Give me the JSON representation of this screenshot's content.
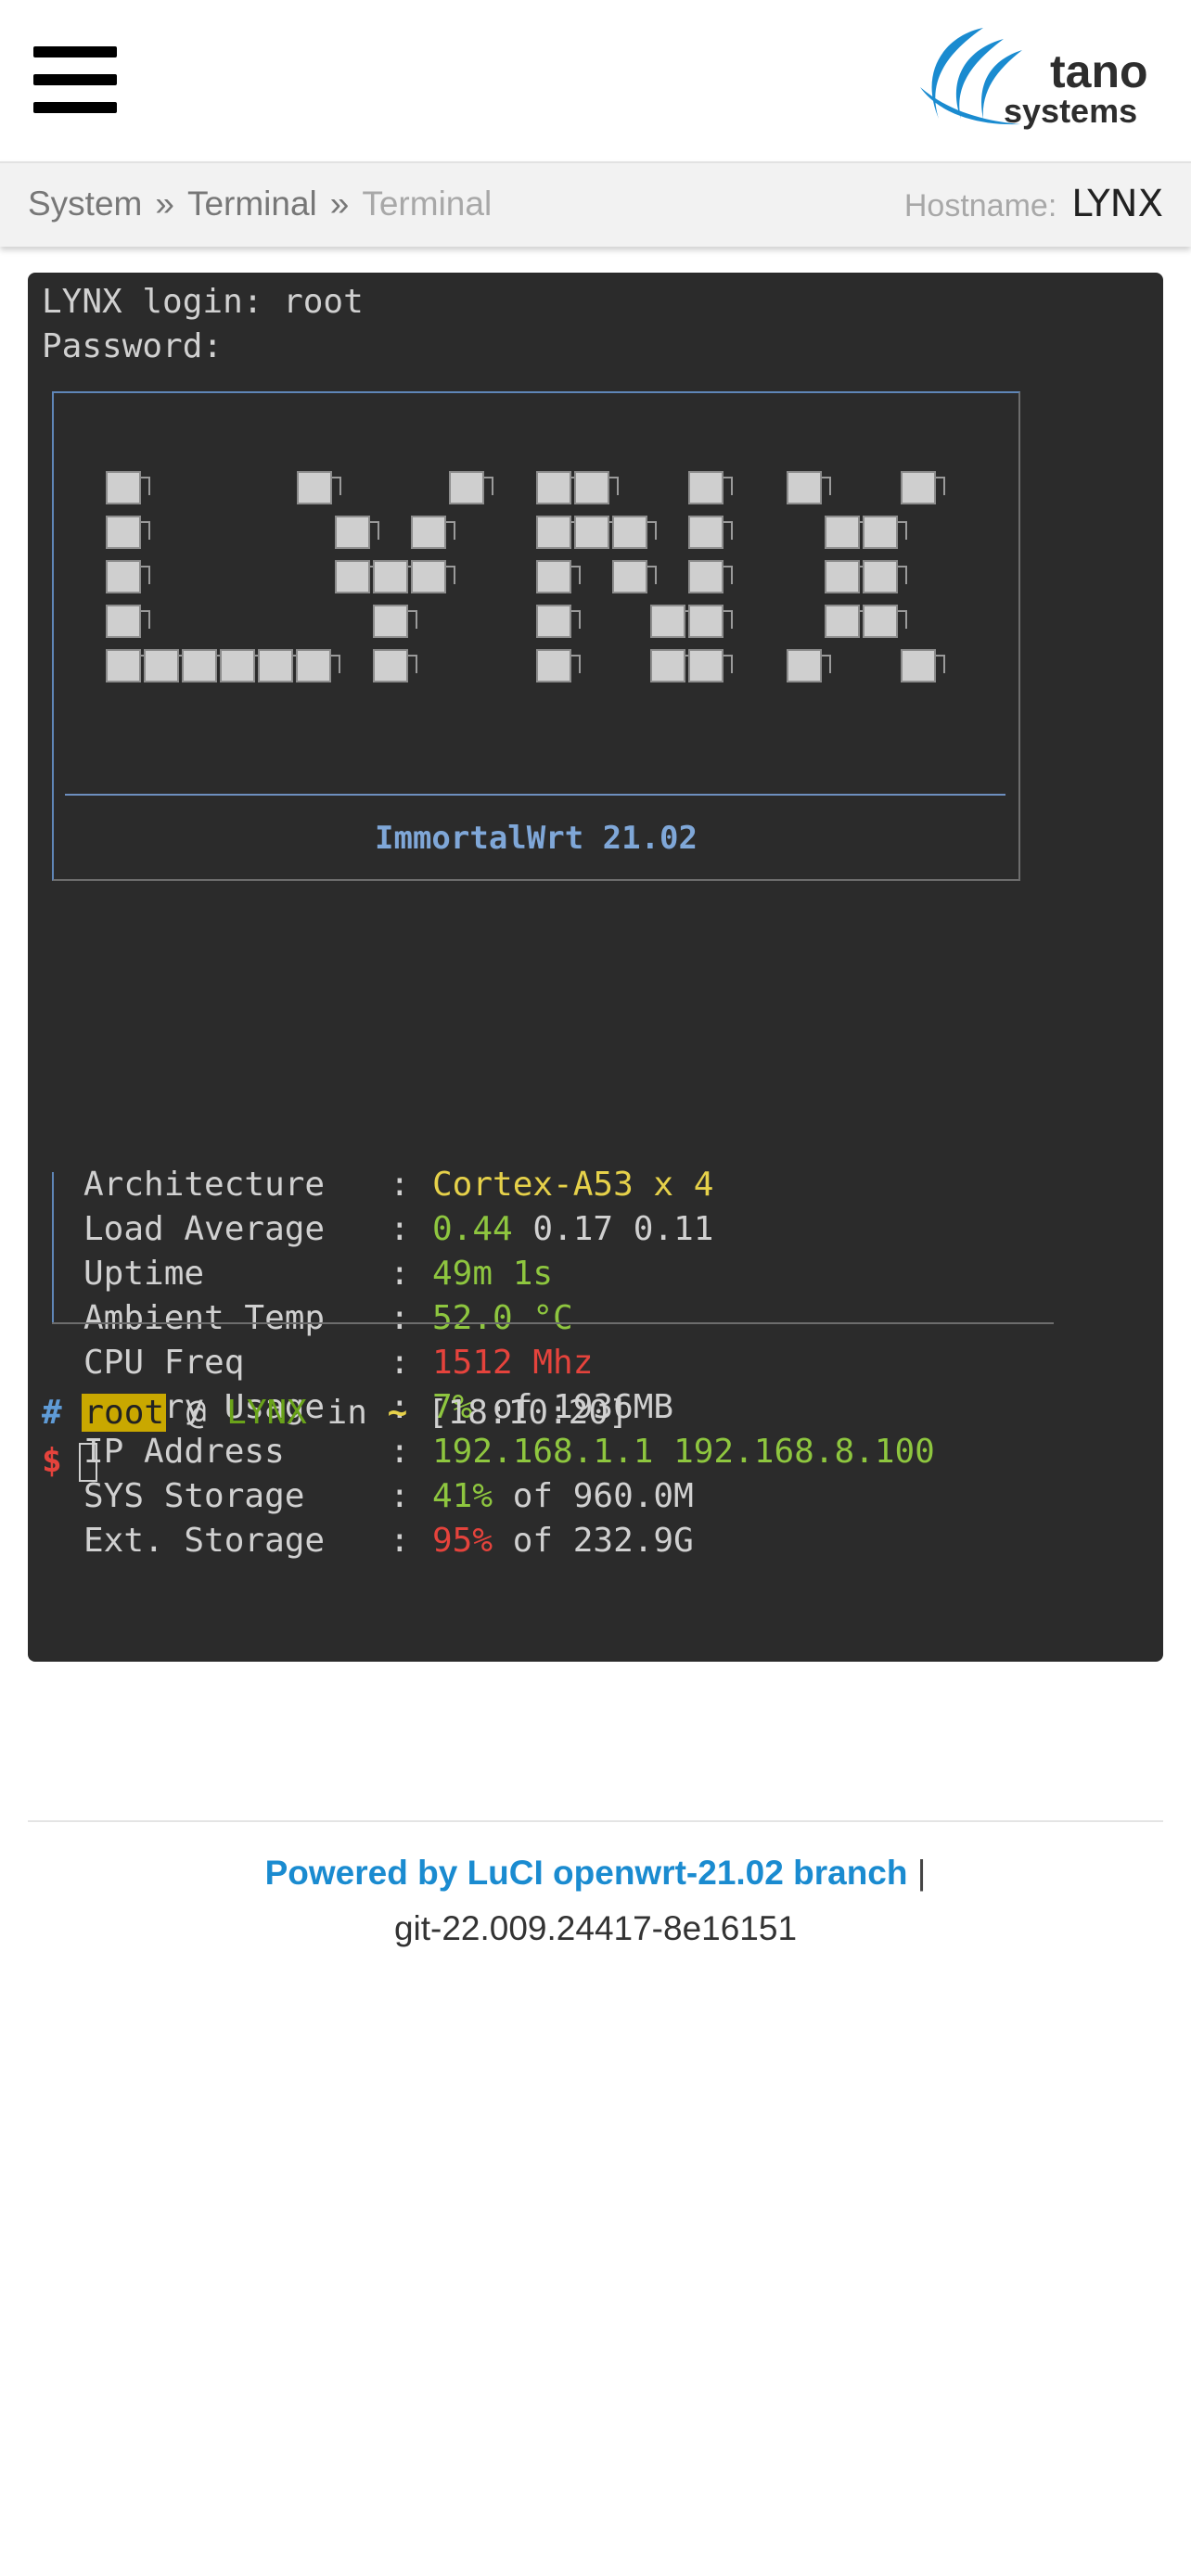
{
  "header": {
    "logo_word1": "tano",
    "logo_word2": "systems",
    "colors": {
      "logo_blue": "#1a8bd0",
      "logo_text": "#2d2d2d"
    }
  },
  "breadcrumb": {
    "items": [
      "System",
      "Terminal",
      "Terminal"
    ],
    "separator": "»"
  },
  "hostname": {
    "label": "Hostname:",
    "value": "LYNX"
  },
  "terminal": {
    "login_line": "LYNX login: root",
    "password_line": "Password:",
    "banner_title": "ImmortalWrt 21.02",
    "sysinfo": [
      {
        "key": "Architecture",
        "sep": ":",
        "parts": [
          {
            "text": "Cortex-A53 x 4",
            "color": "#e6d14a"
          }
        ]
      },
      {
        "key": "Load Average",
        "sep": ":",
        "parts": [
          {
            "text": "0.44",
            "color": "#8ec63f"
          },
          {
            "text": " 0.17 0.11",
            "color": "#d0d0d0"
          }
        ]
      },
      {
        "key": "Uptime",
        "sep": ":",
        "parts": [
          {
            "text": "49m 1s",
            "color": "#8ec63f"
          }
        ]
      },
      {
        "key": "Ambient Temp",
        "sep": ":",
        "parts": [
          {
            "text": "52.0 °C",
            "color": "#8ec63f"
          }
        ]
      },
      {
        "key": "CPU Freq",
        "sep": ":",
        "parts": [
          {
            "text": "1512 Mhz",
            "color": "#e5433c"
          }
        ]
      },
      {
        "key": "Memory Usage",
        "sep": ":",
        "parts": [
          {
            "text": "7%",
            "color": "#8ec63f"
          },
          {
            "text": " of 1936MB",
            "color": "#d0d0d0"
          }
        ]
      },
      {
        "key": "IP Address",
        "sep": ":",
        "parts": [
          {
            "text": "192.168.1.1 192.168.8.100",
            "color": "#8ec63f"
          }
        ]
      },
      {
        "key": "SYS Storage",
        "sep": ":",
        "parts": [
          {
            "text": "41%",
            "color": "#8ec63f"
          },
          {
            "text": " of 960.0M",
            "color": "#d0d0d0"
          }
        ]
      },
      {
        "key": "Ext. Storage",
        "sep": ":",
        "parts": [
          {
            "text": "95%",
            "color": "#e5433c"
          },
          {
            "text": " of 232.9G",
            "color": "#d0d0d0"
          }
        ]
      }
    ],
    "prompt": {
      "hash": "#",
      "user": "root",
      "at": "@",
      "host": "LYNX",
      "in": "in",
      "dir": "~",
      "time": "[18:10:20]",
      "dollar": "$"
    }
  },
  "footer": {
    "link_text": "Powered by LuCI openwrt-21.02 branch",
    "pipe": "|",
    "version": "git-22.009.24417-8e16151"
  }
}
